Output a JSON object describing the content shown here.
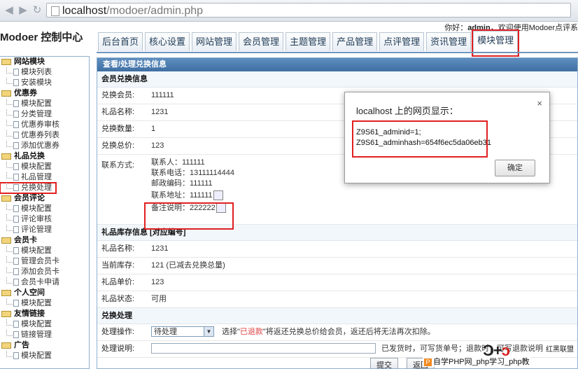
{
  "browser": {
    "url_host": "localhost",
    "url_path": "/modoer/admin.php"
  },
  "header": {
    "logo": "Modoer 控制中心",
    "welcome_prefix": "你好：",
    "user": "admin",
    "welcome_suffix": "，欢迎使用Modoer点评系"
  },
  "tabs": [
    "后台首页",
    "核心设置",
    "网站管理",
    "会员管理",
    "主题管理",
    "产品管理",
    "点评管理",
    "资讯管理",
    "模块管理"
  ],
  "sidebar": [
    {
      "group": "网站模块",
      "items": [
        "模块列表",
        "安装模块"
      ]
    },
    {
      "group": "优惠券",
      "items": [
        "模块配置",
        "分类管理",
        "优惠券审核",
        "优惠券列表",
        "添加优惠券"
      ]
    },
    {
      "group": "礼品兑换",
      "items": [
        "模块配置",
        "礼品管理",
        "兑换处理"
      ]
    },
    {
      "group": "会员评论",
      "items": [
        "模块配置",
        "评论审核",
        "评论管理"
      ]
    },
    {
      "group": "会员卡",
      "items": [
        "模块配置",
        "管理会员卡",
        "添加会员卡",
        "会员卡申请"
      ]
    },
    {
      "group": "个人空间",
      "items": [
        "模块配置"
      ]
    },
    {
      "group": "友情链接",
      "items": [
        "模块配置",
        "链接管理"
      ]
    },
    {
      "group": "广告",
      "items": [
        "模块配置"
      ]
    }
  ],
  "panel": {
    "title": "查看/处理兑换信息",
    "section1": "会员兑换信息",
    "rows1": [
      {
        "label": "兑换会员:",
        "value": "111111"
      },
      {
        "label": "礼品名称:",
        "value": "1231"
      },
      {
        "label": "兑换数量:",
        "value": "1"
      },
      {
        "label": "兑换总价:",
        "value": "123"
      }
    ],
    "contact_label": "联系方式:",
    "contact_lines": [
      "联系人：111111",
      "联系电话：13111114444",
      "邮政编码：111111",
      "联系地址：111111",
      "备注说明：222222"
    ],
    "section2": "礼品库存信息 [对应编号]",
    "rows2": [
      {
        "label": "礼品名称:",
        "value": "1231"
      },
      {
        "label": "当前库存:",
        "value": "121 (已减去兑换总量)"
      },
      {
        "label": "礼品单价:",
        "value": "123"
      },
      {
        "label": "礼品状态:",
        "value": "可用"
      }
    ],
    "section3": "兑换处理",
    "op_label": "处理操作:",
    "op_select": "待处理",
    "op_hint_a": "选择\"",
    "op_hint_red": "已退款",
    "op_hint_b": "\"将返还兑换总价给会员，返还后将无法再次扣除。",
    "note_label": "处理说明:",
    "note_hint": "已发货时，可写货单号；退款时，可写退款说明",
    "submit": "提交",
    "back": "返回"
  },
  "dialog": {
    "title": "localhost 上的网页显示：",
    "line1": "Z9S61_adminid=1;",
    "line2": "Z9S61_adminhash=654f6ec5da06eb31",
    "ok": "确定",
    "close": "×"
  },
  "watermark": {
    "logo_a": "Ɔ+",
    "logo_b": "ɔ",
    "side": "红黑联盟",
    "text": "自学PHP网_php学习_php教"
  }
}
